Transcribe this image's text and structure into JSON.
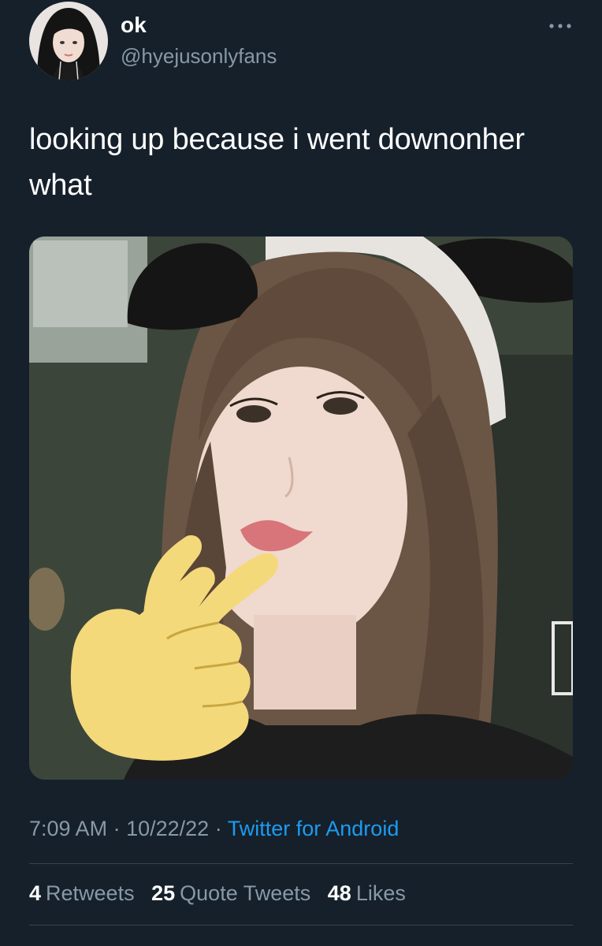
{
  "tweet": {
    "display_name": "ok",
    "username": "@hyejusonlyfans",
    "text": "looking up because i went downonher\nwhat",
    "time": "7:09 AM",
    "date": "10/22/22",
    "separator": "·",
    "source": "Twitter for Android"
  },
  "stats": {
    "retweets": {
      "count": "4",
      "label": "Retweets"
    },
    "quote_tweets": {
      "count": "25",
      "label": "Quote Tweets"
    },
    "likes": {
      "count": "48",
      "label": "Likes"
    }
  },
  "icons": {
    "more": "more-horizontal-icon"
  },
  "colors": {
    "background": "#15202b",
    "secondary_text": "#8899a6",
    "link": "#1d9bf0",
    "divider": "#38444d"
  }
}
